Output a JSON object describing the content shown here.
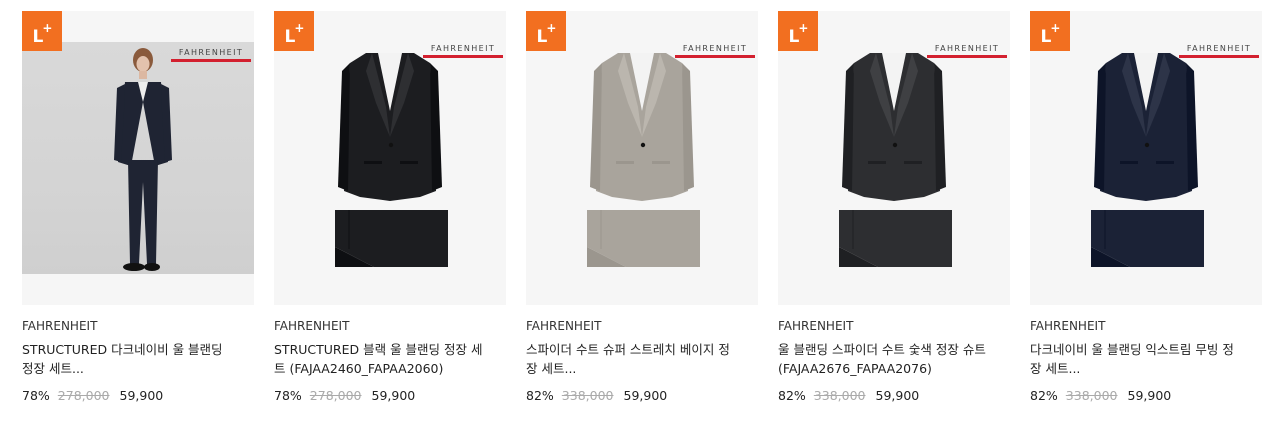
{
  "products": [
    {
      "badge": "L+",
      "logo_text": "FAHRENHEIT",
      "brand": "FAHRENHEIT",
      "name": "STRUCTURED 다크네이비 울 블랜딩 정장 세트...",
      "discount": "78%",
      "original_price": "278,000",
      "sale_price": "59,900",
      "image": "model-photo",
      "suit_color": "#1f2433"
    },
    {
      "badge": "L+",
      "logo_text": "FAHRENHEIT",
      "brand": "FAHRENHEIT",
      "name": "STRUCTURED 블랙 울 블랜딩 정장 세트 (FAJAA2460_FAPAA2060)",
      "discount": "78%",
      "original_price": "278,000",
      "sale_price": "59,900",
      "image": "suit-flatlay",
      "suit_color": "#1c1d20"
    },
    {
      "badge": "L+",
      "logo_text": "FAHRENHEIT",
      "brand": "FAHRENHEIT",
      "name": "스파이더 수트 슈퍼 스트레치 베이지 정장 세트...",
      "discount": "82%",
      "original_price": "338,000",
      "sale_price": "59,900",
      "image": "suit-flatlay",
      "suit_color": "#a9a49c"
    },
    {
      "badge": "L+",
      "logo_text": "FAHRENHEIT",
      "brand": "FAHRENHEIT",
      "name": "울 블랜딩 스파이더 수트 숯색 정장 슈트 (FAJAA2676_FAPAA2076)",
      "discount": "82%",
      "original_price": "338,000",
      "sale_price": "59,900",
      "image": "suit-flatlay",
      "suit_color": "#2d2e31"
    },
    {
      "badge": "L+",
      "logo_text": "FAHRENHEIT",
      "brand": "FAHRENHEIT",
      "name": "다크네이비 울 블랜딩 익스트림 무빙 정장 세트...",
      "discount": "82%",
      "original_price": "338,000",
      "sale_price": "59,900",
      "image": "suit-flatlay",
      "suit_color": "#1b2236"
    }
  ]
}
